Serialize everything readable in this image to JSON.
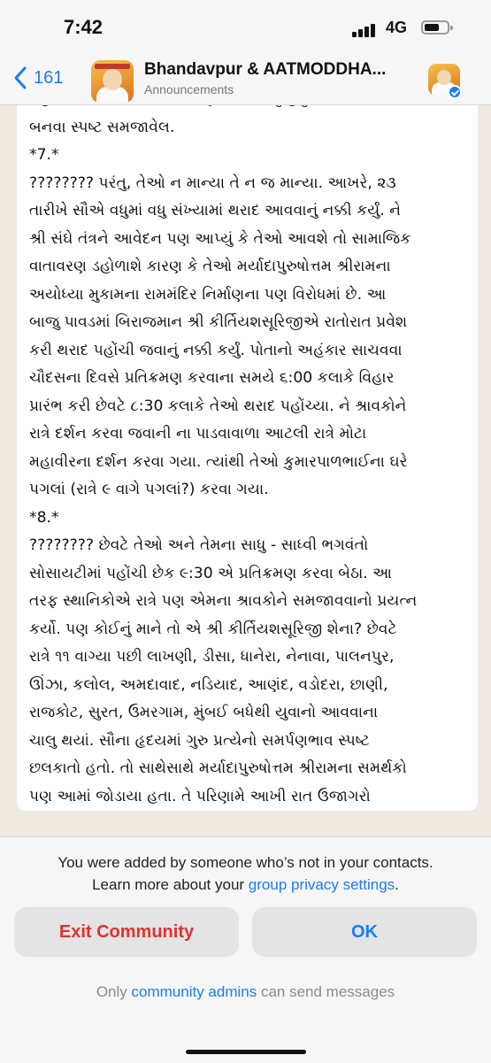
{
  "status_bar": {
    "time": "7:42",
    "network": "4G"
  },
  "header": {
    "back_count": "161",
    "title": "Bhandavpur & AATMODDHA...",
    "subtitle": "Announcements"
  },
  "message": {
    "lines": [
      "પહેલાં દર્શાવેલ વિચાર અંગે પણ સમજાવ્યું હતું ને",
      "બનવા સ્પષ્ટ સમજાવેલ.",
      "*7.*",
      "???????? પરંતુ, તેઓ ન માન્યા તે ન જ માન્યા. આખરે, ૨૩",
      "તારીખે સૌએ વધુમાં વધુ સંખ્યામાં થરાદ આવવાનું નક્કી કર્યું. ને",
      "શ્રી સંઘે તંત્રને આવેદન પણ આપ્યું કે તેઓ આવશે તો સામાજિક",
      "વાતાવરણ ડહોળાશે કારણ કે તેઓ મર્યાદાપુરુષોત્તમ શ્રીરામના",
      "અયોધ્યા મુકામના રામમંદિર નિર્માણના પણ વિરોધમાં છે. આ",
      "બાજુ પાવડમાં બિરાજમાન શ્રી કીર્તિયશસૂરિજીએ રાતોરાત પ્રવેશ",
      "કરી થરાદ પહોંચી જવાનું નક્કી કર્યું. પોતાનો અહંકાર સાચવવા",
      "ચૌદસના દિવસે પ્રતિક્રમણ કરવાના સમયે ૬:00 કલાકે વિહાર",
      "પ્રારંભ કરી છેવટે ૮:30 કલાકે તેઓ થરાદ પહોંચ્યા. ને શ્રાવકોને",
      "રાત્રે દર્શન કરવા જવાની ના પાડવાવાળા આટલી રાત્રે મોટા",
      "મહાવીરના દર્શન કરવા ગયા. ત્યાંથી તેઓ કુમારપાળભાઈના ઘરે",
      "પગલાં (રાત્રે ૯ વાગે પગલાં?) કરવા ગયા.",
      "*8.*",
      "???????? છેવટે તેઓ અને તેમના સાધુ - સાધ્વી ભગવંતો",
      "સોસાયટીમાં પહોંચી છેક ૯:30 એ પ્રતિક્રમણ કરવા બેઠા. આ",
      "તરફ સ્થાનિકોએ રાત્રે પણ એમના શ્રાવકોને સમજાવવાનો પ્રયત્ન",
      "કર્યો. પણ કોઈનું માને તો એ શ્રી કીર્તિયશસૂરિજી શેના? છેવટે",
      "રાત્રે ૧૧ વાગ્યા પછી લાખણી, ડીસા, ધાનેરા, નેનાવા, પાલનપુર,",
      "ઊંઝા, કલોલ, અમદાવાદ, નડિયાદ, આણંદ, વડોદરા, છાણી,",
      "રાજકોટ, સુરત, ઉમરગામ, મુંબઈ બધેથી યુવાનો આવવાના",
      "ચાલુ થયાં. સૌના હૃદયમાં ગુરુ પ્રત્યેનો સમર્પણભાવ સ્પષ્ટ",
      "છલકાતો હતો. તો સાથેસાથે મર્યાદાપુરુષોત્તમ શ્રીરામના સમર્થકો",
      "પણ આમાં જોડાયા હતા. તે પરિણામે આખી રાત ઉજાગરો"
    ]
  },
  "bottom": {
    "notice_line1": "You were added by someone who’s not in your contacts.",
    "notice_line2_prefix": "Learn more about your ",
    "notice_link": "group privacy settings",
    "notice_line2_suffix": ".",
    "exit_label": "Exit Community",
    "ok_label": "OK",
    "admin_prefix": "Only ",
    "admin_link": "community admins",
    "admin_suffix": " can send messages"
  },
  "colors": {
    "accent": "#1a7cf5",
    "danger": "#e0322f",
    "chat_bg": "#efeae2"
  }
}
